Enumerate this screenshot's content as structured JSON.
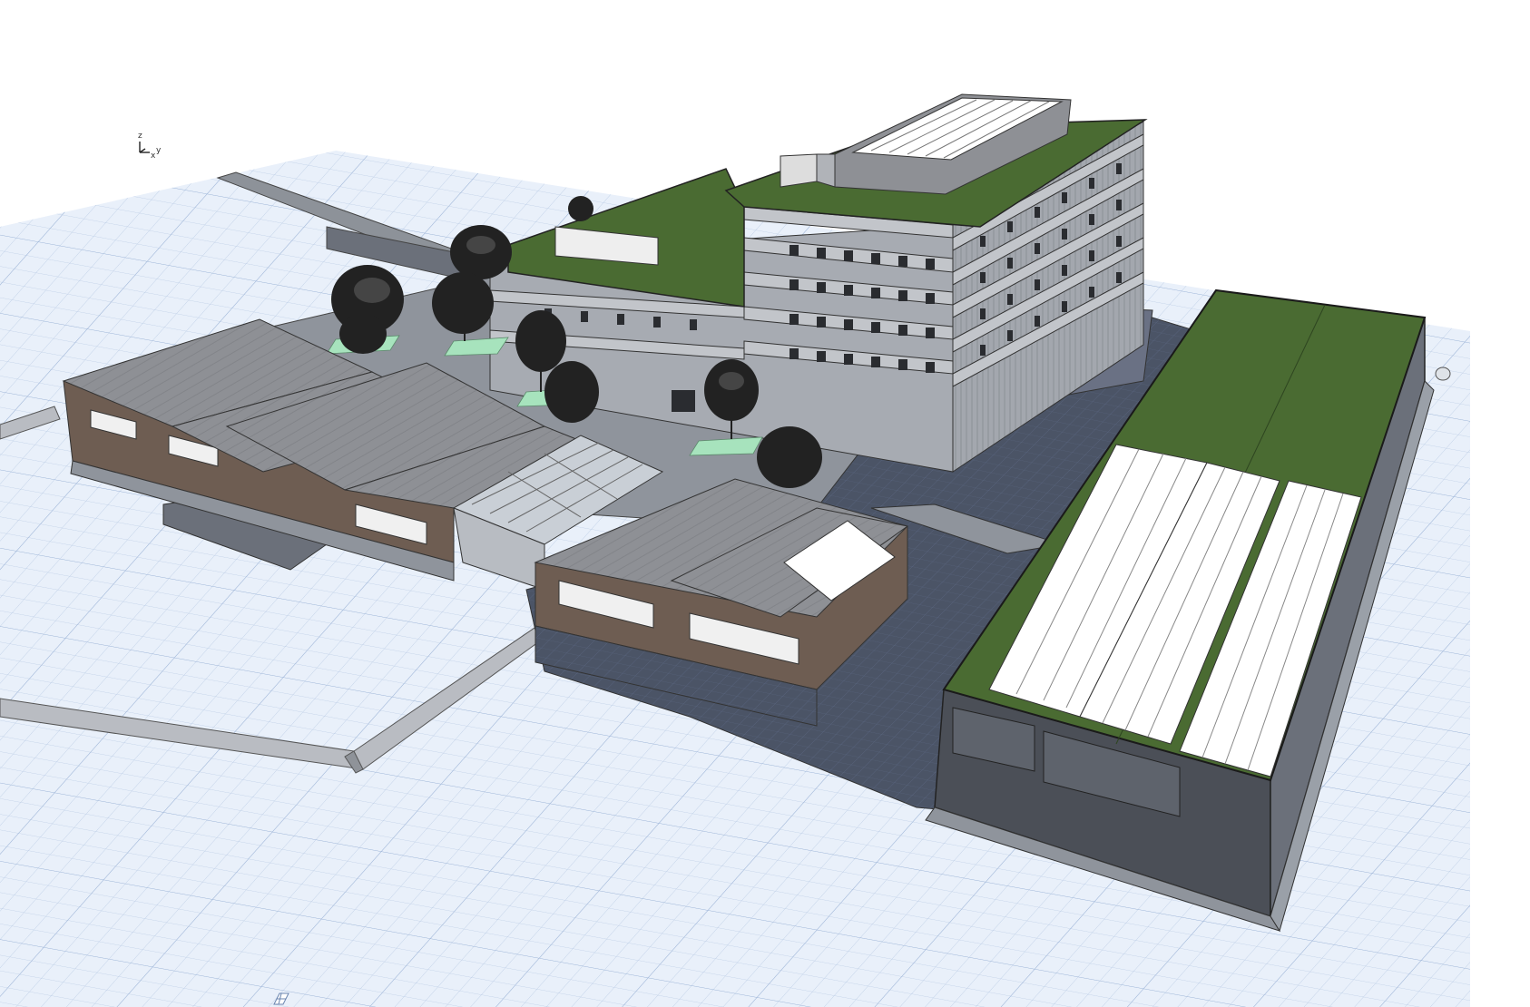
{
  "viewport": {
    "background": "#ffffff",
    "grid_fill": "#e9f0fa",
    "grid_line": "#b7c9e3",
    "grid_major": "#9fb6d8"
  },
  "axis_triad": {
    "z": "z",
    "y": "y",
    "x": "x",
    "icon": "axis-triad-icon"
  },
  "materials": {
    "green_roof": "#4a6b32",
    "metal_roof": "#8e9095",
    "wood_facade": "#6e5d52",
    "concrete": "#9a9ea6",
    "courtyard": "#8f949c",
    "dark_base": "#4b5466",
    "glass_roof": "#c9cfd6",
    "solar_panel": "#ffffff",
    "tree_dark": "#222222",
    "tree_base": "#a7e3bd"
  },
  "status_icon": "grid-snap-icon"
}
